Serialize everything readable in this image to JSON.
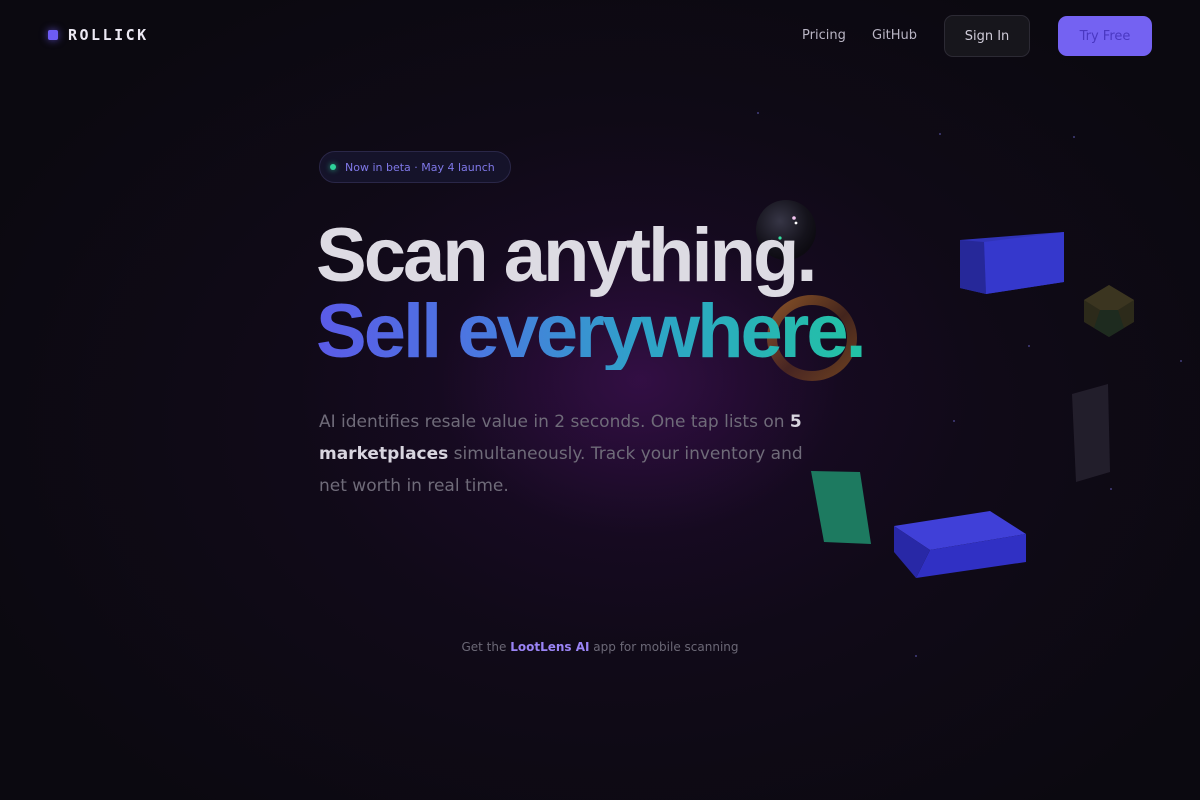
{
  "brand": {
    "name": "ROLLICK"
  },
  "nav": {
    "pricing": "Pricing",
    "github": "GitHub",
    "sign_in": "Sign In",
    "try_free": "Try Free"
  },
  "hero": {
    "badge": "Now in beta · May 4 launch",
    "headline_line1": "Scan anything.",
    "headline_line2": "Sell everywhere.",
    "description_part1": "AI identifies resale value in 2 seconds. One tap lists on ",
    "description_bold1": "5 marketplaces",
    "description_part2": " simultaneously. Track your inventory and net worth in real time."
  },
  "app_cta": {
    "prefix": "Get the ",
    "app_name": "LootLens AI",
    "suffix": " app for mobile scanning"
  },
  "colors": {
    "accent": "#7462f2",
    "status_dot": "#2ed39a",
    "gradient_start": "#5b5be8",
    "gradient_end": "#22c3a4"
  },
  "icons": [
    "brand-mark-icon",
    "status-dot-icon"
  ]
}
